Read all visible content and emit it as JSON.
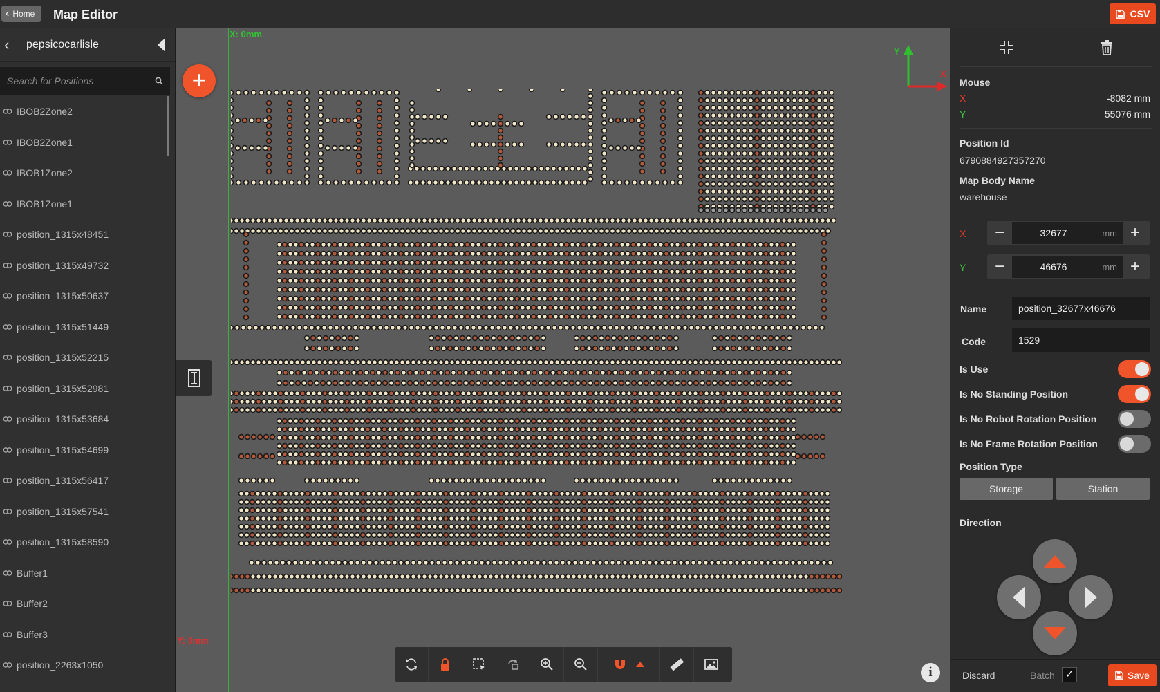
{
  "header": {
    "home_label": "Home",
    "title": "Map Editor",
    "csv_label": "CSV",
    "accent_color": "#e9491f"
  },
  "sidebar": {
    "title": "pepsicocarlisle",
    "search_placeholder": "Search for Positions",
    "items": [
      {
        "label": "IBOB2Zone2"
      },
      {
        "label": "IBOB2Zone1"
      },
      {
        "label": "IBOB1Zone2"
      },
      {
        "label": "IBOB1Zone1"
      },
      {
        "label": "position_1315x48451"
      },
      {
        "label": "position_1315x49732"
      },
      {
        "label": "position_1315x50637"
      },
      {
        "label": "position_1315x51449"
      },
      {
        "label": "position_1315x52215"
      },
      {
        "label": "position_1315x52981"
      },
      {
        "label": "position_1315x53684"
      },
      {
        "label": "position_1315x54699"
      },
      {
        "label": "position_1315x56417"
      },
      {
        "label": "position_1315x57541"
      },
      {
        "label": "position_1315x58590"
      },
      {
        "label": "Buffer1"
      },
      {
        "label": "Buffer2"
      },
      {
        "label": "Buffer3"
      },
      {
        "label": "position_2263x1050"
      }
    ]
  },
  "canvas": {
    "x_origin_label": "X: 0mm",
    "y_origin_label": "Y: 0mm",
    "axis_x": "X",
    "axis_y": "Y",
    "toolbar_icons": [
      "refresh-icon",
      "lock-icon",
      "select-area-icon",
      "rotate-icon",
      "zoom-in-icon",
      "zoom-out-icon",
      "magnet-icon",
      "caret-up-icon",
      "ruler-icon",
      "image-icon"
    ]
  },
  "panel": {
    "mouse_label": "Mouse",
    "mouse_x_axis": "X",
    "mouse_x": "-8082 mm",
    "mouse_y_axis": "Y",
    "mouse_y": "55076 mm",
    "position_id_label": "Position Id",
    "position_id": "6790884927357270",
    "map_body_label": "Map Body Name",
    "map_body": "warehouse",
    "x_label": "X",
    "x_value": "32677",
    "y_label": "Y",
    "y_value": "46676",
    "unit": "mm",
    "name_label": "Name",
    "name_value": "position_32677x46676",
    "code_label": "Code",
    "code_value": "1529",
    "is_use_label": "Is Use",
    "is_use": true,
    "no_standing_label": "Is No Standing Position",
    "no_standing": true,
    "no_robot_rot_label": "Is No Robot Rotation Position",
    "no_robot_rot": false,
    "no_frame_rot_label": "Is No Frame Rotation Position",
    "no_frame_rot": false,
    "position_type_label": "Position Type",
    "type_storage": "Storage",
    "type_station": "Station",
    "direction_label": "Direction",
    "discard_label": "Discard",
    "batch_label": "Batch",
    "batch_checked": true,
    "save_label": "Save"
  }
}
